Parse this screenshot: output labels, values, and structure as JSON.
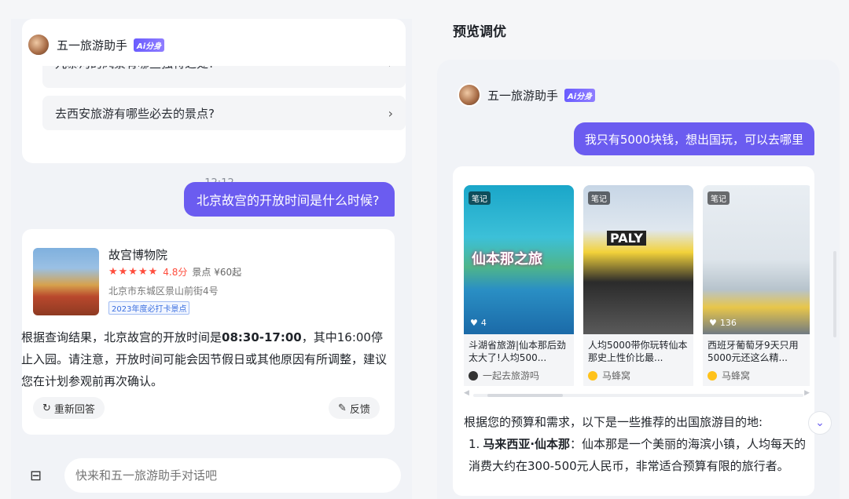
{
  "left": {
    "bot": {
      "name": "五一旅游助手",
      "badge": "Ai分身"
    },
    "suggestions": [
      {
        "text": "九寨沟的风景有哪些独特之处?"
      },
      {
        "text": "去西安旅游有哪些必去的景点?"
      }
    ],
    "timestamp": "12:12",
    "user_message": "北京故宫的开放时间是什么时候?",
    "poi": {
      "title": "故宫博物院",
      "stars": "★★★★★",
      "score": "4.8分",
      "category": "景点 ¥60起",
      "address": "北京市东城区景山前街4号",
      "tag": "2023年度必打卡景点"
    },
    "answer": {
      "before": "根据查询结果，北京故宫的开放时间是",
      "highlight": "08:30-17:00",
      "after": "，其中16:00停止入园。请注意，开放时间可能会因节假日或其他原因有所调整，建议您在计划参观前再次确认。"
    },
    "actions": {
      "regenerate": "重新回答",
      "feedback": "反馈"
    },
    "input_placeholder": "快来和五一旅游助手对话吧"
  },
  "right": {
    "title": "预览调优",
    "bot": {
      "name": "五一旅游助手",
      "badge": "Ai分身"
    },
    "user_message": "我只有5000块钱，想出国玩，可以去哪里",
    "notes": [
      {
        "tag": "笔记",
        "likes": "4",
        "title": "斗湖省旅游|仙本那后劲太大了!人均500...",
        "author": "一起去旅游吗",
        "img_text": "仙本那之旅"
      },
      {
        "tag": "笔记",
        "likes": "",
        "title": "人均5000带你玩转仙本那史上性价比最...",
        "author": "马蜂窝",
        "img_text": "PALY"
      },
      {
        "tag": "笔记",
        "likes": "136",
        "title": "西班牙葡萄牙9天只用5000元还这么精...",
        "author": "马蜂窝",
        "img_text": ""
      }
    ],
    "intro": "根据您的预算和需求，以下是一些推荐的出国旅游目的地:",
    "items": [
      {
        "num": "1.",
        "name": "马来西亚·仙本那",
        "desc": "：仙本那是一个美丽的海滨小镇，人均每天的消费大约在300-500元人民币，非常适合预算有限的旅行者。"
      }
    ]
  },
  "colors": {
    "accent": "#6b5cf0",
    "star": "#ff4d3d"
  }
}
